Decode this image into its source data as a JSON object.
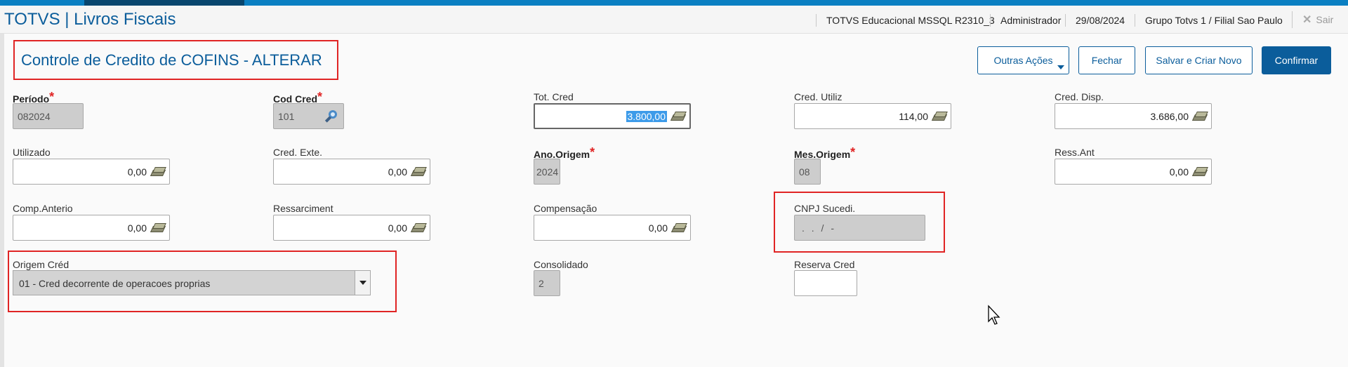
{
  "header": {
    "app_title": "TOTVS | Livros Fiscais",
    "environment": "TOTVS Educacional MSSQL R2310_3",
    "user": "Administrador",
    "date": "29/08/2024",
    "branch": "Grupo Totvs 1 / Filial Sao Paulo",
    "exit_label": "Sair"
  },
  "form": {
    "title": "Controle de Credito de COFINS - ALTERAR"
  },
  "actions": {
    "other_actions": "Outras Ações",
    "close": "Fechar",
    "save_new": "Salvar e Criar Novo",
    "confirm": "Confirmar"
  },
  "fields": {
    "periodo": {
      "label": "Período",
      "value": "082024",
      "required": "*"
    },
    "cod_cred": {
      "label": "Cod Cred",
      "value": "101",
      "required": "*"
    },
    "tot_cred": {
      "label": "Tot. Cred",
      "value": "3.800,00"
    },
    "cred_utiliz": {
      "label": "Cred. Utiliz",
      "value": "114,00"
    },
    "cred_disp": {
      "label": "Cred. Disp.",
      "value": "3.686,00"
    },
    "utilizado": {
      "label": "Utilizado",
      "value": "0,00"
    },
    "cred_exte": {
      "label": "Cred. Exte.",
      "value": "0,00"
    },
    "ano_origem": {
      "label": "Ano.Origem",
      "value": "2024",
      "required": "*"
    },
    "mes_origem": {
      "label": "Mes.Origem",
      "value": "08",
      "required": "*"
    },
    "ress_ant": {
      "label": "Ress.Ant",
      "value": "0,00"
    },
    "comp_anterio": {
      "label": "Comp.Anterio",
      "value": "0,00"
    },
    "ressarcimento": {
      "label": "Ressarciment",
      "value": "0,00"
    },
    "compensacao": {
      "label": "Compensação",
      "value": "0,00"
    },
    "cnpj_sucedi": {
      "label": "CNPJ Sucedi.",
      "value": ". . / -"
    },
    "origem_cred": {
      "label": "Origem Créd",
      "value": "01 - Cred decorrente de operacoes proprias"
    },
    "consolidado": {
      "label": "Consolidado",
      "value": "2"
    },
    "reserva_cred": {
      "label": "Reserva Cred",
      "value": ""
    }
  },
  "colors": {
    "brand_blue": "#0b5d9b",
    "highlight_red": "#e02424",
    "readonly_gray": "#cdcdcd"
  },
  "icons": {
    "money": "money-bills-icon",
    "search": "magnifier-icon",
    "dropdown": "chevron-down-icon",
    "close": "close-x-icon"
  }
}
